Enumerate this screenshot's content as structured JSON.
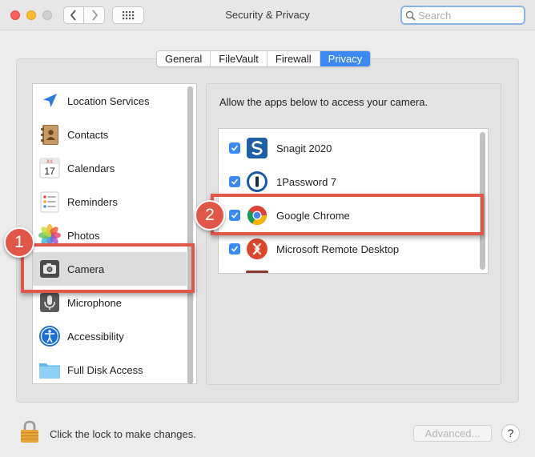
{
  "window": {
    "title": "Security & Privacy",
    "search_placeholder": "Search"
  },
  "tabs": [
    {
      "label": "General",
      "active": false
    },
    {
      "label": "FileVault",
      "active": false
    },
    {
      "label": "Firewall",
      "active": false
    },
    {
      "label": "Privacy",
      "active": true
    }
  ],
  "categories": [
    {
      "label": "Location Services",
      "icon": "location-arrow-icon"
    },
    {
      "label": "Contacts",
      "icon": "contacts-book-icon"
    },
    {
      "label": "Calendars",
      "icon": "calendar-icon",
      "icon_text": {
        "month": "JUL",
        "day": "17"
      }
    },
    {
      "label": "Reminders",
      "icon": "reminders-list-icon"
    },
    {
      "label": "Photos",
      "icon": "photos-flower-icon"
    },
    {
      "label": "Camera",
      "icon": "camera-icon",
      "selected": true
    },
    {
      "label": "Microphone",
      "icon": "microphone-icon"
    },
    {
      "label": "Accessibility",
      "icon": "accessibility-icon"
    },
    {
      "label": "Full Disk Access",
      "icon": "folder-icon"
    }
  ],
  "privacy": {
    "prompt": "Allow the apps below to access your camera.",
    "apps": [
      {
        "label": "Snagit 2020",
        "checked": true,
        "icon": "snagit-icon"
      },
      {
        "label": "1Password 7",
        "checked": true,
        "icon": "onepassword-icon"
      },
      {
        "label": "Google Chrome",
        "checked": true,
        "icon": "chrome-icon"
      },
      {
        "label": "Microsoft Remote Desktop",
        "checked": true,
        "icon": "remote-desktop-icon"
      }
    ]
  },
  "annotations": [
    {
      "number": "1",
      "color": "#e0574a"
    },
    {
      "number": "2",
      "color": "#e0574a"
    }
  ],
  "footer": {
    "lock_text": "Click the lock to make changes.",
    "advanced_label": "Advanced...",
    "help_label": "?"
  },
  "colors": {
    "accent": "#3b89f2",
    "annotation": "#e0574a"
  }
}
